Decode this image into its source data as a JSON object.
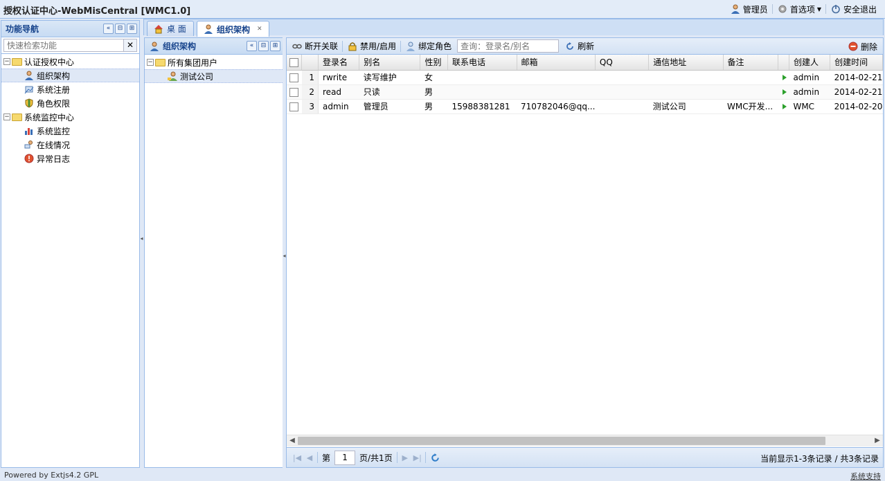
{
  "app": {
    "title": "授权认证中心-WebMisCentral [WMC1.0]"
  },
  "header": {
    "user_label": "管理员",
    "prefs_label": "首选项",
    "logout_label": "安全退出"
  },
  "nav": {
    "title": "功能导航",
    "search_placeholder": "快速检索功能",
    "clear_symbol": "✕",
    "groups": [
      {
        "label": "认证授权中心",
        "items": [
          "组织架构",
          "系统注册",
          "角色权限"
        ]
      },
      {
        "label": "系统监控中心",
        "items": [
          "系统监控",
          "在线情况",
          "异常日志"
        ]
      }
    ]
  },
  "tabs": [
    {
      "label": "桌 面"
    },
    {
      "label": "组织架构",
      "active": true
    }
  ],
  "org": {
    "title": "组织架构",
    "root": "所有集团用户",
    "child": "测试公司"
  },
  "toolbar": {
    "unlink": "断开关联",
    "toggle": "禁用/启用",
    "bind_role": "绑定角色",
    "search_placeholder": "查询：登录名/别名",
    "refresh": "刷新",
    "delete": "删除"
  },
  "grid": {
    "columns": [
      "登录名",
      "别名",
      "性别",
      "联系电话",
      "邮箱",
      "QQ",
      "通信地址",
      "备注",
      "创建人",
      "创建时间"
    ],
    "rows": [
      {
        "n": "1",
        "login": "rwrite",
        "alias": "读写维护",
        "sex": "女",
        "phone": "",
        "email": "",
        "qq": "",
        "addr": "",
        "note": "",
        "creator": "admin",
        "time": "2014-02-21"
      },
      {
        "n": "2",
        "login": "read",
        "alias": "只读",
        "sex": "男",
        "phone": "",
        "email": "",
        "qq": "",
        "addr": "",
        "note": "",
        "creator": "admin",
        "time": "2014-02-21"
      },
      {
        "n": "3",
        "login": "admin",
        "alias": "管理员",
        "sex": "男",
        "phone": "15988381281",
        "email": "710782046@qq...",
        "qq": "",
        "addr": "测试公司",
        "note": "WMC开发...",
        "creator": "WMC",
        "time": "2014-02-20"
      }
    ]
  },
  "pager": {
    "page_prefix": "第",
    "page_value": "1",
    "page_suffix": "页/共1页",
    "info": "当前显示1-3条记录 / 共3条记录"
  },
  "footer": {
    "powered": "Powered by Extjs4.2 GPL",
    "support": "系统支持"
  }
}
